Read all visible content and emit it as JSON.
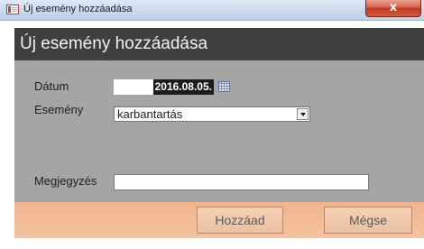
{
  "window": {
    "title": "Új esemény hozzáadása",
    "close_glyph": "x"
  },
  "form": {
    "header_title": "Új esemény hozzáadása",
    "date_label": "Dátum",
    "date_value": "2016.08.05.",
    "event_label": "Esemény",
    "event_value": "karbantartás",
    "note_label": "Megjegyzés",
    "note_value": ""
  },
  "buttons": {
    "add_label": "Hozzáad",
    "cancel_label": "Mégse"
  },
  "colors": {
    "header_bg": "#3f3f3f",
    "body_bg": "#a5a5a5",
    "footer_bg": "#f2b48c",
    "close_red": "#c23a22"
  },
  "icons": [
    "form-icon",
    "calendar-icon",
    "dropdown-arrow-icon",
    "close-icon"
  ]
}
